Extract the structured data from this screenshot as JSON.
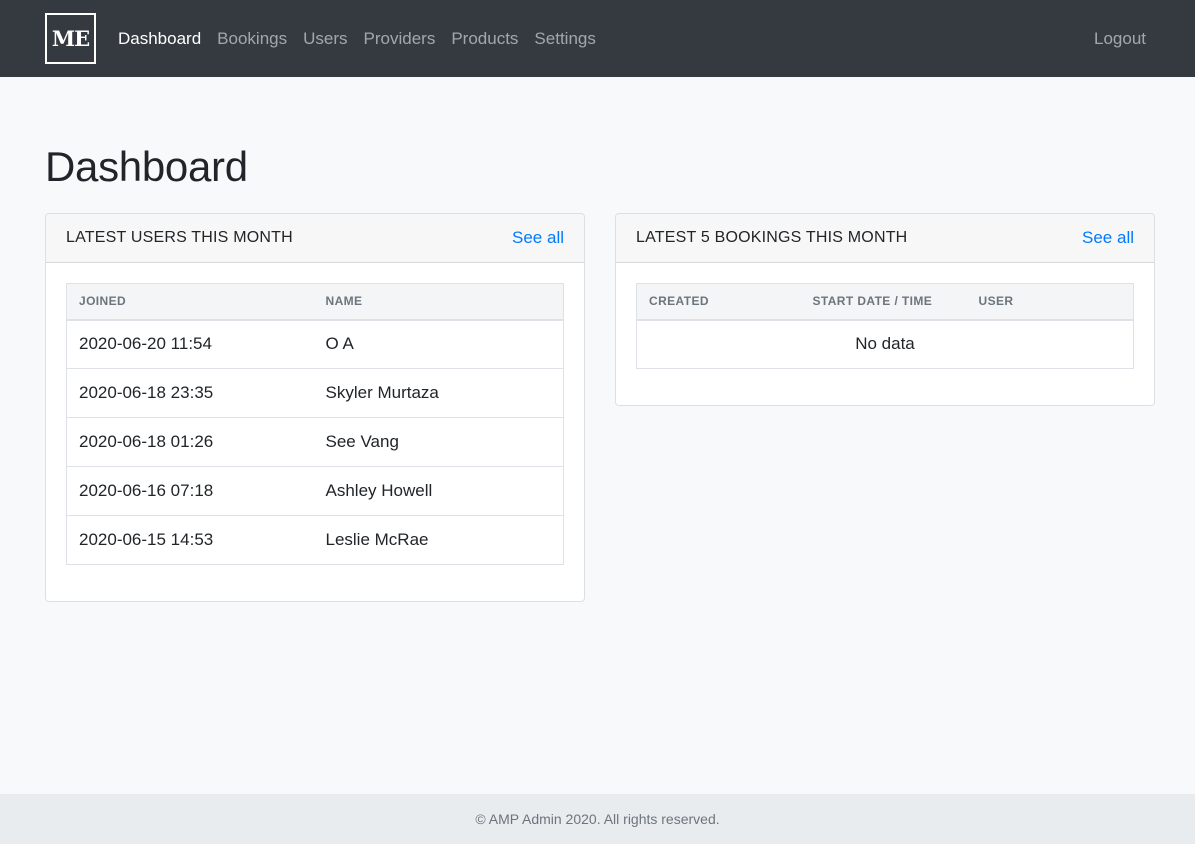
{
  "navbar": {
    "brand": "ME",
    "links": [
      {
        "label": "Dashboard",
        "active": true
      },
      {
        "label": "Bookings"
      },
      {
        "label": "Users"
      },
      {
        "label": "Providers"
      },
      {
        "label": "Products"
      },
      {
        "label": "Settings"
      }
    ],
    "logout": "Logout"
  },
  "page": {
    "title": "Dashboard"
  },
  "users_card": {
    "title": "LATEST USERS THIS MONTH",
    "see_all": "See all",
    "columns": [
      "JOINED",
      "NAME"
    ],
    "rows": [
      {
        "joined": "2020-06-20 11:54",
        "name": "O A"
      },
      {
        "joined": "2020-06-18 23:35",
        "name": "Skyler Murtaza"
      },
      {
        "joined": "2020-06-18 01:26",
        "name": "See Vang"
      },
      {
        "joined": "2020-06-16 07:18",
        "name": "Ashley Howell"
      },
      {
        "joined": "2020-06-15 14:53",
        "name": "Leslie McRae"
      }
    ]
  },
  "bookings_card": {
    "title": "LATEST 5 BOOKINGS THIS MONTH",
    "see_all": "See all",
    "columns": [
      "CREATED",
      "START DATE / TIME",
      "USER"
    ],
    "empty": "No data"
  },
  "footer": {
    "text": "© AMP Admin 2020. All rights reserved."
  },
  "colors": {
    "navbar_bg": "#343a40",
    "link_blue": "#007bff",
    "footer_bg": "#e9ecef",
    "page_bg": "#f8f9fa"
  }
}
